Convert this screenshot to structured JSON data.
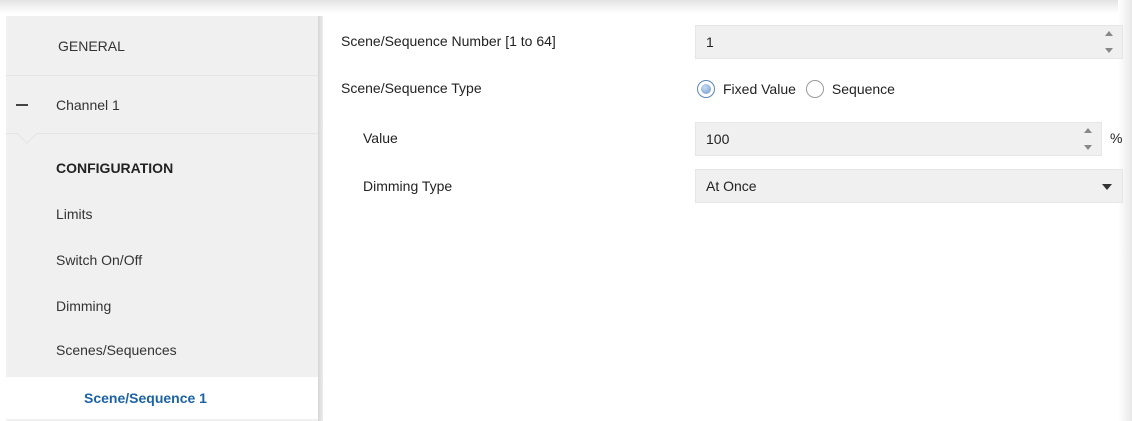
{
  "sidebar": {
    "general_label": "GENERAL",
    "channel_label": "Channel 1",
    "items": [
      {
        "label": "CONFIGURATION"
      },
      {
        "label": "Limits"
      },
      {
        "label": "Switch On/Off"
      },
      {
        "label": "Dimming"
      },
      {
        "label": "Scenes/Sequences"
      },
      {
        "label": "Scene/Sequence 1"
      }
    ]
  },
  "form": {
    "scene_number": {
      "label": "Scene/Sequence Number [1 to 64]",
      "value": "1"
    },
    "scene_type": {
      "label": "Scene/Sequence Type",
      "options": [
        "Fixed Value",
        "Sequence"
      ],
      "selected": "Fixed Value"
    },
    "value": {
      "label": "Value",
      "value": "100",
      "unit": "%"
    },
    "dimming_type": {
      "label": "Dimming Type",
      "selected": "At Once"
    }
  },
  "colors": {
    "sidebar_bg": "#f0f0f0",
    "selected_text": "#1c62a6",
    "radio_accent": "#6b97cc"
  },
  "icons": {
    "collapse": "minus-icon",
    "spinner": "spinner-arrows-icon",
    "dropdown": "chevron-down-icon"
  }
}
